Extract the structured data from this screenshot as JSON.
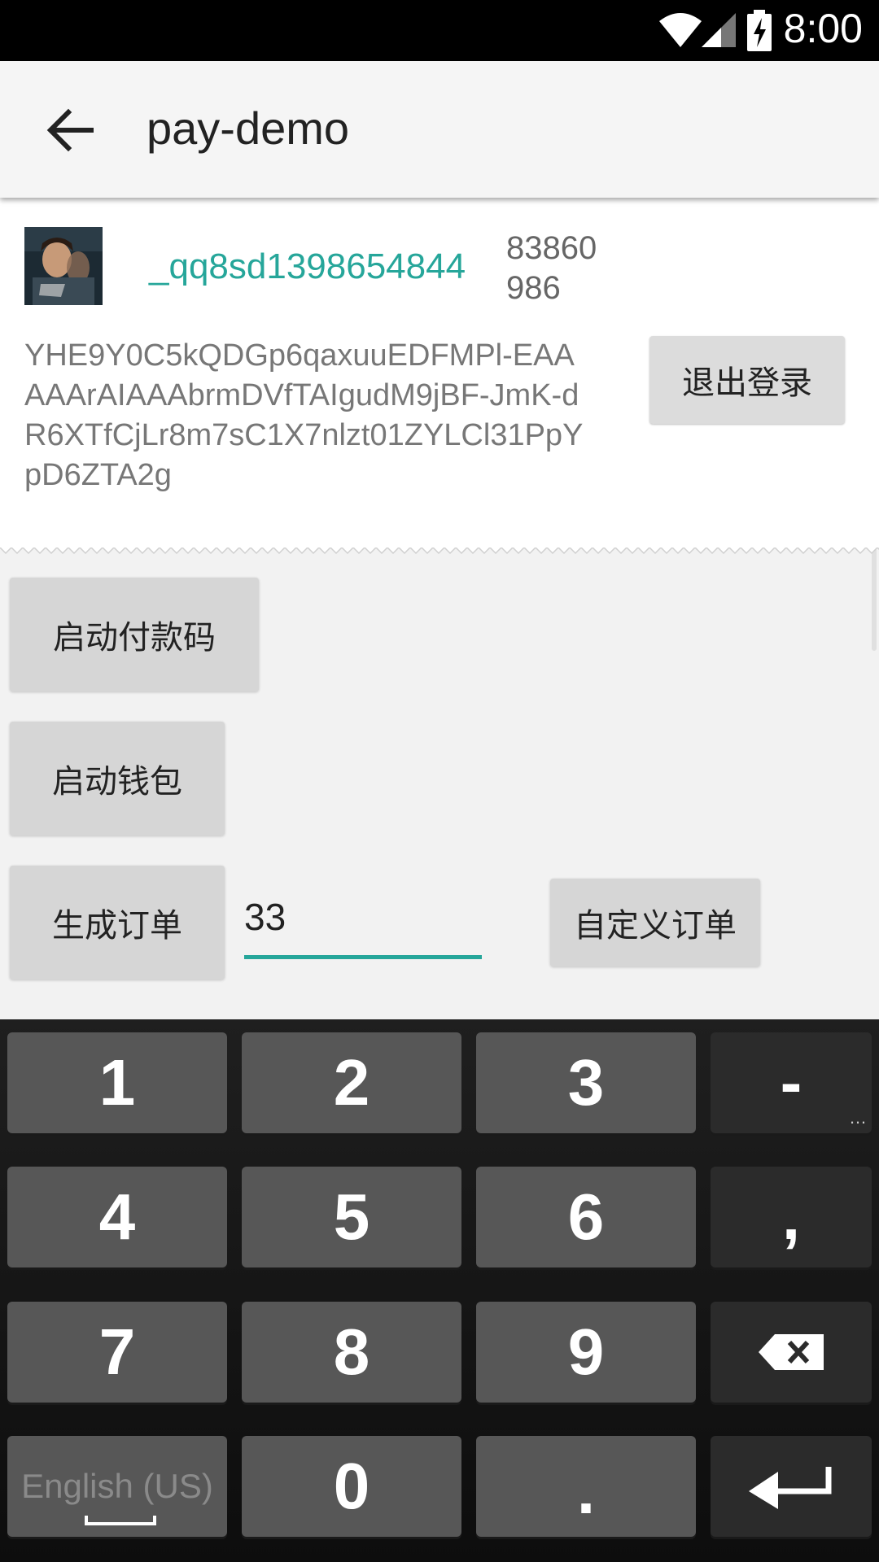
{
  "status_bar": {
    "time": "8:00",
    "icons": [
      "wifi-icon",
      "signal-icon",
      "battery-charging-icon"
    ]
  },
  "app_bar": {
    "title": "pay-demo",
    "back_icon": "arrow-back-icon"
  },
  "user_card": {
    "username": "_qq8sd1398654844",
    "uid": "83860986",
    "token": "YHE9Y0C5kQDGp6qaxuuEDFMPl-EAAAAArAIAAAbrmDVfTAIgudM9jBF-JmK-dR6XTfCjLr8m7sC1X7nlzt01ZYLCl31PpYpD6ZTA2g",
    "logout_label": "退出登录"
  },
  "actions": {
    "start_paycode_label": "启动付款码",
    "start_wallet_label": "启动钱包",
    "create_order_label": "生成订单",
    "amount_value": "33",
    "custom_order_label": "自定义订单"
  },
  "keyboard": {
    "rows": [
      [
        "1",
        "2",
        "3",
        "-"
      ],
      [
        "4",
        "5",
        "6",
        ","
      ],
      [
        "7",
        "8",
        "9",
        "⌫"
      ],
      [
        "English (US)",
        "0",
        ".",
        "↵"
      ]
    ],
    "space_label": "English (US)"
  },
  "colors": {
    "accent": "#26a69a",
    "button": "#d6d6d6",
    "keyboard_bg": "#151515"
  }
}
